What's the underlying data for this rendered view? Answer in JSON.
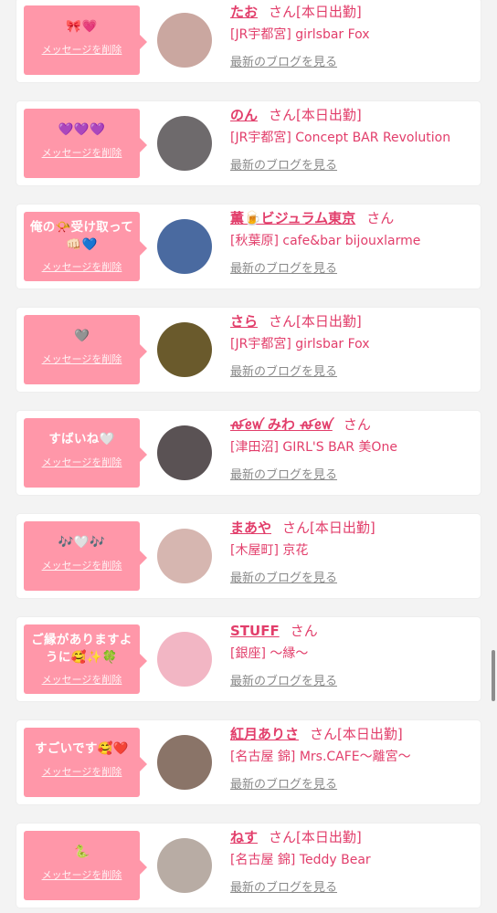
{
  "delete_label": "メッセージを削除",
  "blog_label": "最新のブログを見る",
  "san_label": "さん",
  "items": [
    {
      "message": "🎀💗",
      "name": "たお",
      "today_label": "[本日出勤]",
      "shop": "[JR宇都宮] girlsbar Fox",
      "avatar_color": "#caa7a0"
    },
    {
      "message": "💜💜💜",
      "name": "のん",
      "today_label": "[本日出勤]",
      "shop": "[JR宇都宮] Concept BAR Revolution",
      "avatar_color": "#6e6a6c"
    },
    {
      "message": "俺の📯受け取って👊🏻💙",
      "name": "薫🍺ビジュラム東京",
      "today_label": "",
      "shop": "[秋葉原] cafe&bar bijouxlarme",
      "avatar_color": "#4a6aa0"
    },
    {
      "message": "🩶",
      "name": "さら",
      "today_label": "[本日出勤]",
      "shop": "[JR宇都宮] girlsbar Fox",
      "avatar_color": "#6a5a2c"
    },
    {
      "message": "すばいね🤍",
      "name": "ꫛꫀꪝ みわ ꫛꫀꪝ",
      "today_label": "",
      "shop": "[津田沼] GIRL'S BAR 美One",
      "avatar_color": "#5a5254"
    },
    {
      "message": "🎶🤍🎶",
      "name": "まあや",
      "today_label": "[本日出勤]",
      "shop": "[木屋町] 京花",
      "avatar_color": "#d6b6b0"
    },
    {
      "message": "ご縁がありますように🥰✨🍀",
      "name": "STUFF",
      "today_label": "",
      "shop": "[銀座] 〜縁〜",
      "avatar_color": "#f2b6c4"
    },
    {
      "message": "すごいです🥰❤️",
      "name": "紅月ありさ",
      "today_label": "[本日出勤]",
      "shop": "[名古屋 錦] Mrs.CAFE〜離宮〜",
      "avatar_color": "#8a7468"
    },
    {
      "message": "🐍",
      "name": "ねす",
      "today_label": "[本日出勤]",
      "shop": "[名古屋 錦] Teddy Bear",
      "avatar_color": "#b8aca4"
    }
  ]
}
